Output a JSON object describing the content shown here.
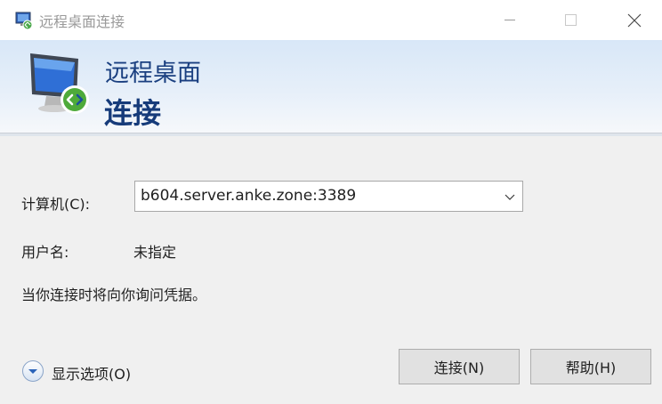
{
  "window": {
    "title": "远程桌面连接"
  },
  "banner": {
    "title": "远程桌面",
    "subtitle": "连接"
  },
  "form": {
    "computer_label": "计算机(C):",
    "computer_value": "b604.server.anke.zone:3389",
    "username_label": "用户名:",
    "username_value": "未指定",
    "info_text": "当你连接时将向你询问凭据。"
  },
  "footer": {
    "options_label": "显示选项(O)",
    "connect_button": "连接(N)",
    "help_button": "帮助(H)"
  }
}
